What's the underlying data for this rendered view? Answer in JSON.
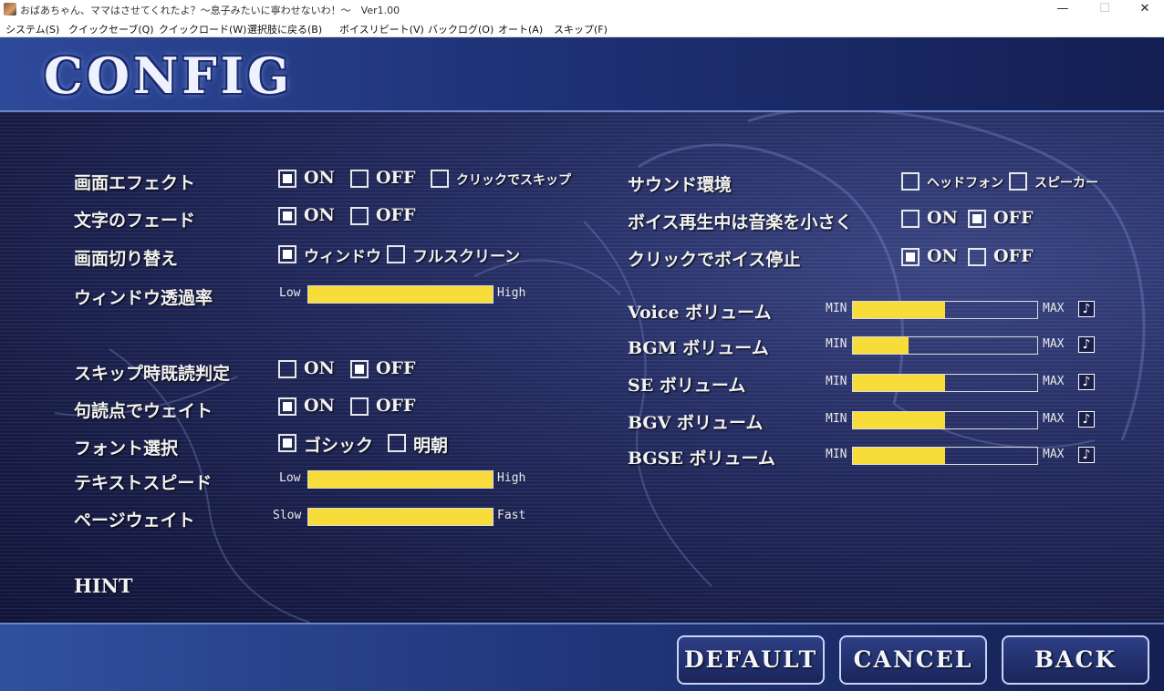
{
  "window": {
    "title": "おばあちゃん、ママはさせてくれたよ？～息子みたいに寧わせないわ！～　Ver1.00",
    "minimize": "—",
    "maximize": "☐",
    "close": "✕"
  },
  "menu": [
    "システム(S)",
    "クイックセーブ(Q)",
    "クイックロード(W)",
    "選択肢に戻る(B)",
    "ボイスリピート(V)",
    "バックログ(O)",
    "オート(A)",
    "スキップ(F)"
  ],
  "screen_title": "CONFIG",
  "left": {
    "effect": {
      "label": "画面エフェクト",
      "options": [
        {
          "text": "ON",
          "checked": true
        },
        {
          "text": "OFF",
          "checked": false
        },
        {
          "text": "クリックでスキップ",
          "checked": false
        }
      ]
    },
    "fade": {
      "label": "文字のフェード",
      "options": [
        {
          "text": "ON",
          "checked": true
        },
        {
          "text": "OFF",
          "checked": false
        }
      ]
    },
    "screen": {
      "label": "画面切り替え",
      "options": [
        {
          "text": "ウィンドウ",
          "checked": true
        },
        {
          "text": "フルスクリーン",
          "checked": false
        }
      ]
    },
    "opacity": {
      "label": "ウィンドウ透過率",
      "min": "Low",
      "max": "High",
      "value": 1.0
    },
    "skip_read": {
      "label": "スキップ時既読判定",
      "options": [
        {
          "text": "ON",
          "checked": false
        },
        {
          "text": "OFF",
          "checked": true
        }
      ]
    },
    "punct_wait": {
      "label": "句読点でウェイト",
      "options": [
        {
          "text": "ON",
          "checked": true
        },
        {
          "text": "OFF",
          "checked": false
        }
      ]
    },
    "font": {
      "label": "フォント選択",
      "options": [
        {
          "text": "ゴシック",
          "checked": true
        },
        {
          "text": "明朝",
          "checked": false
        }
      ]
    },
    "text_speed": {
      "label": "テキストスピード",
      "min": "Low",
      "max": "High",
      "value": 1.0
    },
    "page_wait": {
      "label": "ページウェイト",
      "min": "Slow",
      "max": "Fast",
      "value": 1.0
    },
    "hint": "HINT"
  },
  "right": {
    "sound_env": {
      "label": "サウンド環境",
      "options": [
        {
          "text": "ヘッドフォン",
          "checked": false
        },
        {
          "text": "スピーカー",
          "checked": false
        }
      ]
    },
    "voice_duck": {
      "label": "ボイス再生中は音楽を小さく",
      "options": [
        {
          "text": "ON",
          "checked": false
        },
        {
          "text": "OFF",
          "checked": true
        }
      ]
    },
    "click_voice_stop": {
      "label": "クリックでボイス停止",
      "options": [
        {
          "text": "ON",
          "checked": true
        },
        {
          "text": "OFF",
          "checked": false
        }
      ]
    },
    "volumes": [
      {
        "label": "Voice ボリューム",
        "min": "MIN",
        "max": "MAX",
        "value": 0.5
      },
      {
        "label": "BGM ボリューム",
        "min": "MIN",
        "max": "MAX",
        "value": 0.3
      },
      {
        "label": "SE ボリューム",
        "min": "MIN",
        "max": "MAX",
        "value": 0.5
      },
      {
        "label": "BGV ボリューム",
        "min": "MIN",
        "max": "MAX",
        "value": 0.5
      },
      {
        "label": "BGSE ボリューム",
        "min": "MIN",
        "max": "MAX",
        "value": 0.5
      }
    ],
    "test_icon": "♪"
  },
  "buttons": {
    "default": "DEFAULT",
    "cancel": "CANCEL",
    "back": "BACK"
  },
  "colors": {
    "slider_fill": "#f7dc3a",
    "header": "#20347a",
    "background": "#171c45"
  }
}
